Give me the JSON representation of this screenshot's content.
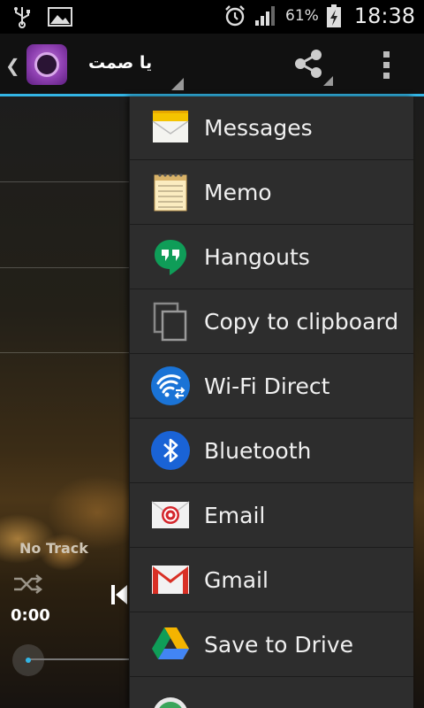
{
  "status_bar": {
    "battery_percent": "61%",
    "time": "18:38",
    "icons": [
      "usb-icon",
      "image-notification-icon",
      "alarm-icon",
      "signal-icon",
      "battery-charging-icon"
    ]
  },
  "action_bar": {
    "title": "يا صمت",
    "icons": [
      "back-chevron-icon",
      "app-icon",
      "share-icon",
      "overflow-menu-icon"
    ],
    "accent_color": "#33b5e5"
  },
  "player": {
    "track_label": "No Track",
    "time": "0:00",
    "icons": [
      "shuffle-icon",
      "previous-icon"
    ]
  },
  "share_menu": {
    "items": [
      {
        "label": "Messages",
        "icon": "messages-icon"
      },
      {
        "label": "Memo",
        "icon": "memo-icon"
      },
      {
        "label": "Hangouts",
        "icon": "hangouts-icon"
      },
      {
        "label": "Copy to clipboard",
        "icon": "copy-icon"
      },
      {
        "label": "Wi-Fi Direct",
        "icon": "wifi-direct-icon"
      },
      {
        "label": "Bluetooth",
        "icon": "bluetooth-icon"
      },
      {
        "label": "Email",
        "icon": "email-icon"
      },
      {
        "label": "Gmail",
        "icon": "gmail-icon"
      },
      {
        "label": "Save to Drive",
        "icon": "drive-icon"
      }
    ]
  }
}
